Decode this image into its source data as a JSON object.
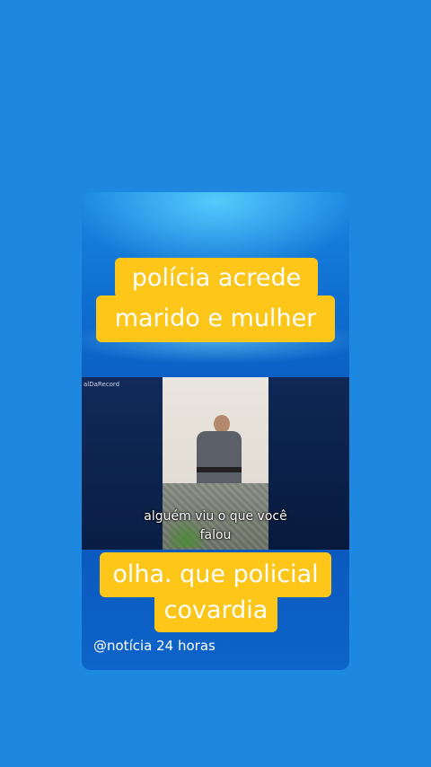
{
  "caption_top": [
    "polícia acrede",
    "marido e mulher"
  ],
  "video": {
    "watermark": "alDaRecord",
    "subtitle_line1": "alguém viu o que você",
    "subtitle_line2": "falou"
  },
  "caption_bottom": [
    "olha. que policial",
    "covardia"
  ],
  "handle": "@notícia 24 horas",
  "colors": {
    "background": "#1e88e0",
    "caption_bg": "#ffc61a",
    "caption_text": "#ffffff"
  }
}
